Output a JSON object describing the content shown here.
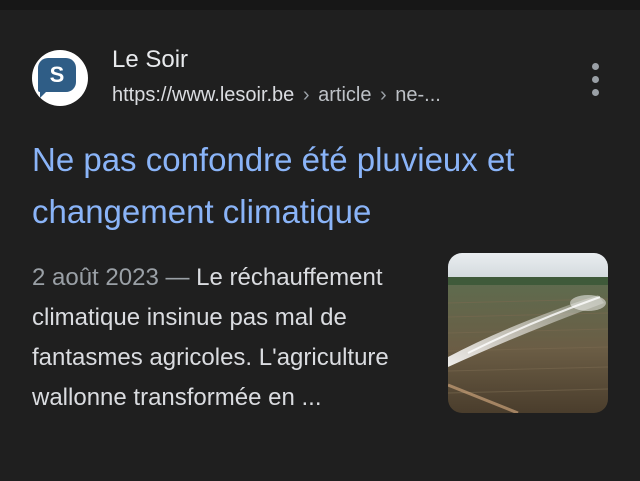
{
  "result": {
    "site_name": "Le Soir",
    "favicon_letter": "S",
    "breadcrumb": {
      "domain": "https://www.lesoir.be",
      "separator": "›",
      "parts": [
        "article",
        "ne-..."
      ]
    },
    "title": "Ne pas confondre été pluvieux et changement climatique",
    "snippet": {
      "date": "2 août 2023",
      "dash": "—",
      "text": "Le réchauffement climatique insinue pas mal de fantasmes agricoles. L'agriculture wallonne transformée en ..."
    },
    "menu_icon": "more-vert-icon",
    "thumbnail_subject": "field-irrigation-sprinkler-image"
  },
  "colors": {
    "background": "#1f1f1f",
    "link": "#8ab4f8",
    "text": "#dadce0",
    "muted": "#9aa0a6",
    "favicon_blue": "#2f5d86"
  }
}
